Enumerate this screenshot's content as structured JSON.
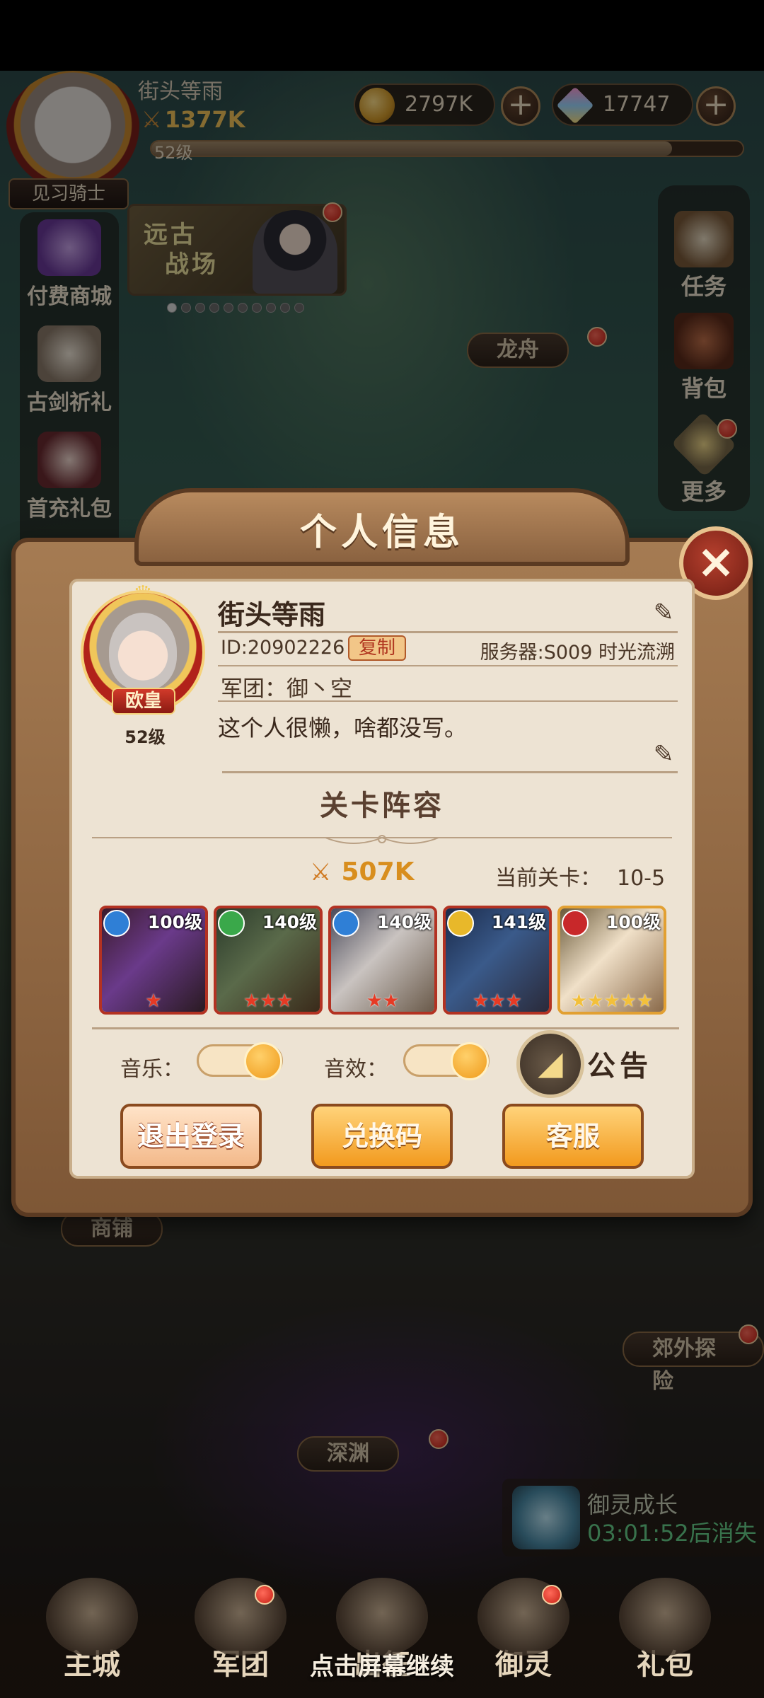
{
  "hud": {
    "player_name": "街头等雨",
    "power": "1377K",
    "level": "52级",
    "rank_title": "见习骑士",
    "gold": "2797K",
    "gems": "17747",
    "exp_fraction": 0.88
  },
  "left_menu": [
    {
      "label": "付费商城",
      "icon": "gift-box-icon"
    },
    {
      "label": "古剑祈礼",
      "icon": "sword-character-icon"
    },
    {
      "label": "首充礼包",
      "icon": "first-recharge-icon"
    }
  ],
  "right_menu": [
    {
      "label": "任务",
      "icon": "quest-scroll-icon"
    },
    {
      "label": "背包",
      "icon": "backpack-icon"
    },
    {
      "label": "更多",
      "icon": "more-grid-icon"
    }
  ],
  "event_banner": {
    "text_line1": "远古",
    "text_line2": "战场",
    "page_count": 10,
    "active_page": 0
  },
  "map_labels": {
    "dragon": "龙舟",
    "shop": "商铺",
    "explore": "郊外探险",
    "abyss": "深渊"
  },
  "growth": {
    "title": "御灵成长",
    "timer": "03:01:52后消失"
  },
  "bottom_nav": [
    {
      "label": "主城",
      "icon": "main-city-icon"
    },
    {
      "label": "军团",
      "icon": "legion-icon"
    },
    {
      "label": "出征",
      "icon": "expedition-icon"
    },
    {
      "label": "御灵",
      "icon": "spirit-crystal-icon"
    },
    {
      "label": "礼包",
      "icon": "gift-shop-icon"
    }
  ],
  "continue_hint": "点击屏幕继续",
  "modal": {
    "title": "个人信息",
    "close_label": "×",
    "profile": {
      "name": "街头等雨",
      "id": "ID:20902226",
      "copy_label": "复制",
      "server": "服务器:S009 时光流溯",
      "legion": "军团：御丶空",
      "signature": "这个人很懒，啥都没写。",
      "vip_title": "欧皇",
      "level": "52级"
    },
    "lineup": {
      "title": "关卡阵容",
      "power": "507K",
      "stage_label": "当前关卡：",
      "stage_value": "10-5",
      "heroes": [
        {
          "level": "100级",
          "stars": "★",
          "element_color": "#2f7fd6"
        },
        {
          "level": "140级",
          "stars": "★★★",
          "element_color": "#3aa84a"
        },
        {
          "level": "140级",
          "stars": "★★",
          "element_color": "#2f7fd6"
        },
        {
          "level": "141级",
          "stars": "★★★",
          "element_color": "#e8b82a"
        },
        {
          "level": "100级",
          "stars": "★★★★★",
          "element_color": "#c8282a"
        }
      ]
    },
    "settings": {
      "music_label": "音乐：",
      "sfx_label": "音效：",
      "music_on": true,
      "sfx_on": true,
      "notice_label": "公告"
    },
    "buttons": {
      "logout": "退出登录",
      "redeem": "兑换码",
      "service": "客服"
    }
  },
  "colors": {
    "accent_gold": "#f29a1e",
    "frame_brown": "#7e5736",
    "panel": "#ede3d3",
    "red": "#b33222"
  }
}
